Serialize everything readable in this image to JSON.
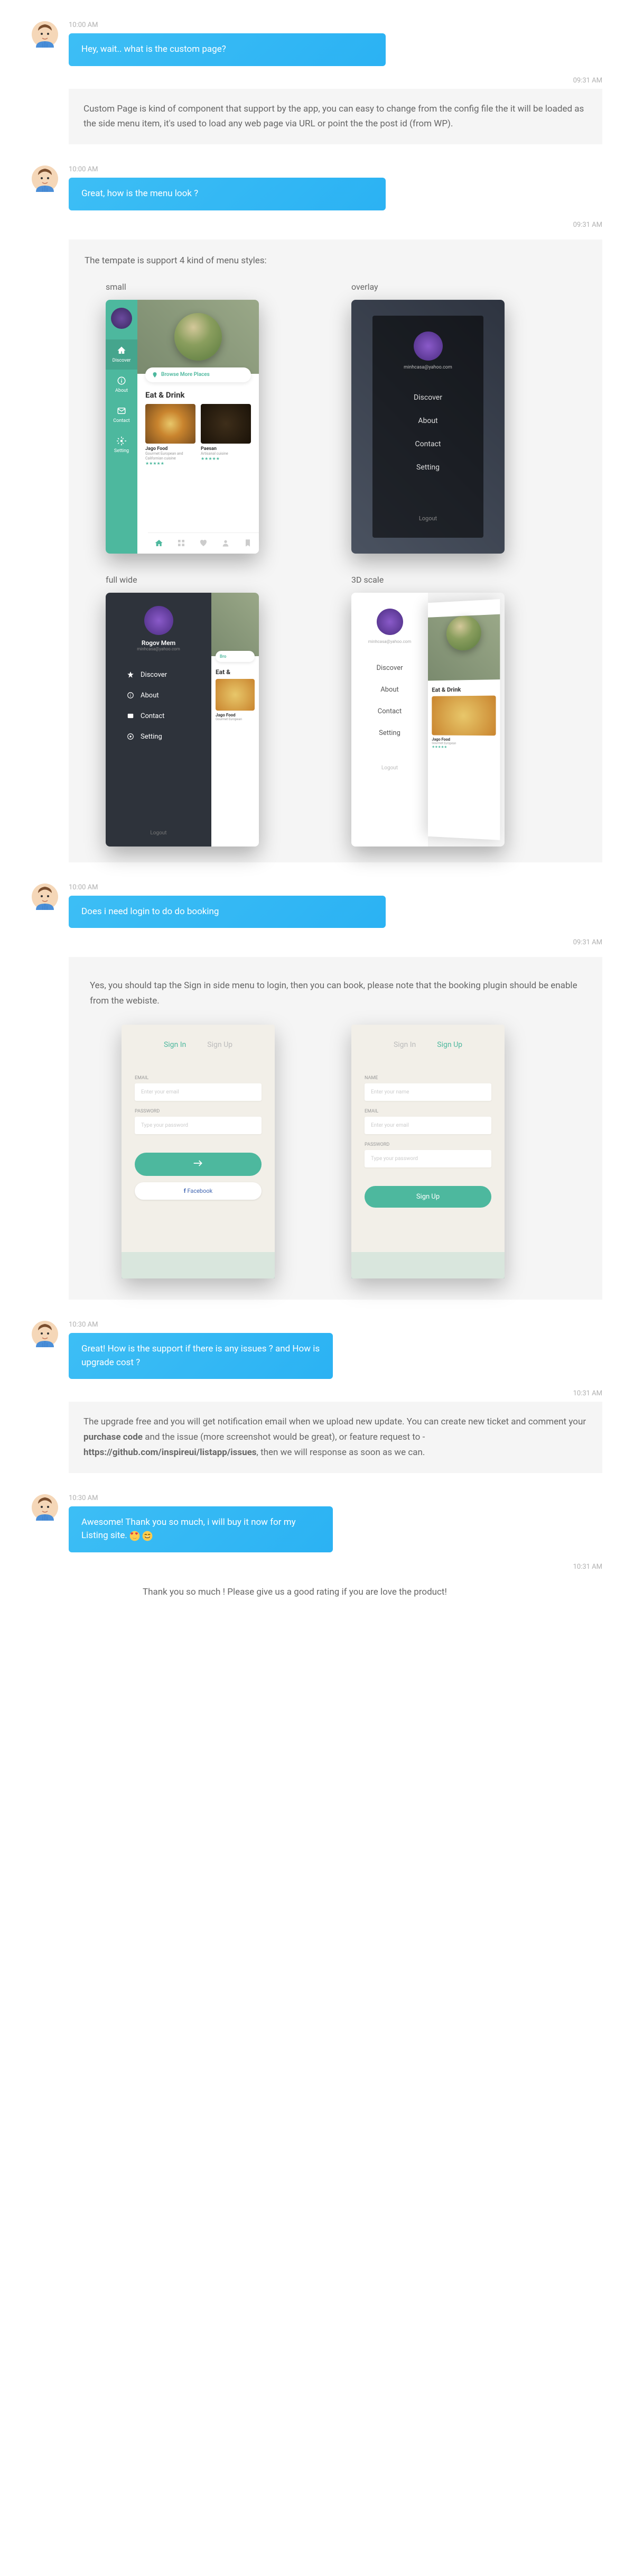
{
  "messages": [
    {
      "time": "10:00 AM",
      "text": "Hey, wait.. what is the custom page?"
    },
    {
      "time": "10:00 AM",
      "text": "Great, how is the menu look ?"
    },
    {
      "time": "10:00 AM",
      "text": "Does i need login to do do booking"
    },
    {
      "time": "10:30 AM",
      "text": "Great! How is the support if there is any issues ? and How is upgrade cost ?"
    },
    {
      "time": "10:30 AM",
      "text": "Awesome! Thank you so much, i will buy it now for my Listing site. "
    }
  ],
  "replies": [
    {
      "time": "09:31 AM",
      "text": "Custom Page is kind of component that support by the app, you can easy to change from the config file the it will be loaded as the side menu item, it's used to load any web page via URL or point the the post id (from WP)."
    },
    {
      "time": "09:31 AM",
      "title": "The tempate is support 4 kind of menu styles:"
    },
    {
      "time": "09:31 AM",
      "text": "Yes, you should tap the Sign in side menu to login, then you can book, please note that the booking plugin should be enable from the webiste."
    },
    {
      "time": "10:31 AM",
      "text_pre": "The upgrade free and you will get notification email when we upload new update. You can create new ticket and comment your ",
      "bold1": "purchase code",
      "text_mid": " and the issue (more screenshot would be great), or feature request to - ",
      "bold2": "https://github.com/inspireui/listapp/issues",
      "text_post": ", then we will response as soon as we can."
    },
    {
      "time": "10:31 AM",
      "text": "Thank you so much ! Please give us a good rating if you are love the product!"
    }
  ],
  "menu_styles": {
    "small": "small",
    "overlay": "overlay",
    "fullwide": "full wide",
    "scale3d": "3D scale"
  },
  "small_menu": {
    "items": [
      "Discover",
      "About",
      "Contact",
      "Setting"
    ],
    "browse": "Browse More Places",
    "eat": "Eat & Drink",
    "card1": {
      "title": "Jago Food",
      "sub": "Gourmet European and Californian cuisine"
    },
    "card2": {
      "title": "Paesan",
      "sub": "Artisanal cuisine"
    }
  },
  "overlay_menu": {
    "email": "minhcasa@yahoo.com",
    "items": [
      "Discover",
      "About",
      "Contact",
      "Setting"
    ],
    "logout": "Logout"
  },
  "fullwide_menu": {
    "name": "Rogov Mem",
    "email": "minhcasa@yahoo.com",
    "items": [
      "Discover",
      "About",
      "Contact",
      "Setting"
    ],
    "logout": "Logout",
    "browse": "Bro",
    "eat": "Eat &",
    "card": "Jago Food"
  },
  "scale3d_menu": {
    "email": "minhcasa@yahoo.com",
    "items": [
      "Discover",
      "About",
      "Contact",
      "Setting"
    ],
    "logout": "Logout",
    "eat": "Eat & Drink",
    "card": "Jago Food"
  },
  "login": {
    "signin": "Sign In",
    "signup": "Sign Up",
    "email": "EMAIL",
    "password": "PASSWORD",
    "name": "NAME",
    "email_ph": "Enter your email",
    "pw_ph": "Type your password",
    "name_ph": "Enter your name",
    "signin_btn": "Sign In",
    "signup_btn": "Sign Up",
    "fb": "Facebook"
  }
}
